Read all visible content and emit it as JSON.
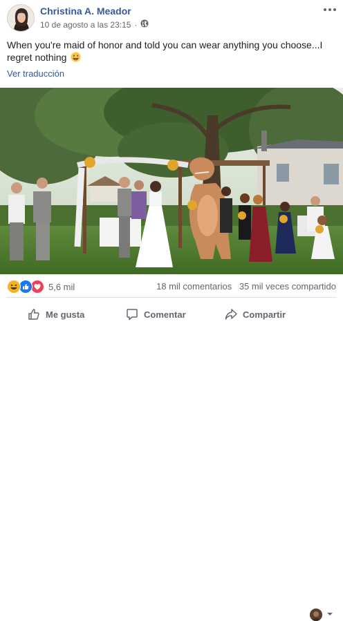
{
  "post": {
    "author": "Christina A. Meador",
    "timestamp": "10 de agosto a las 23:15",
    "privacy_icon": "globe-icon",
    "text": "When you're maid of honor and told you can wear anything you choose...I regret nothing",
    "emoji": "grinning-tongue-emoji",
    "translate_link": "Ver traducción"
  },
  "reactions": {
    "icons": [
      "haha-icon",
      "like-icon",
      "love-icon"
    ],
    "count": "5,6 mil"
  },
  "stats": {
    "comments": "18 mil comentarios",
    "shares": "35 mil veces compartido"
  },
  "actions": {
    "like": "Me gusta",
    "comment": "Comentar",
    "share": "Compartir"
  },
  "colors": {
    "link": "#385898",
    "secondary_text": "#606770",
    "like_blue": "#1877f2",
    "love_red": "#f33e58",
    "haha_yellow": "#f7b125"
  }
}
